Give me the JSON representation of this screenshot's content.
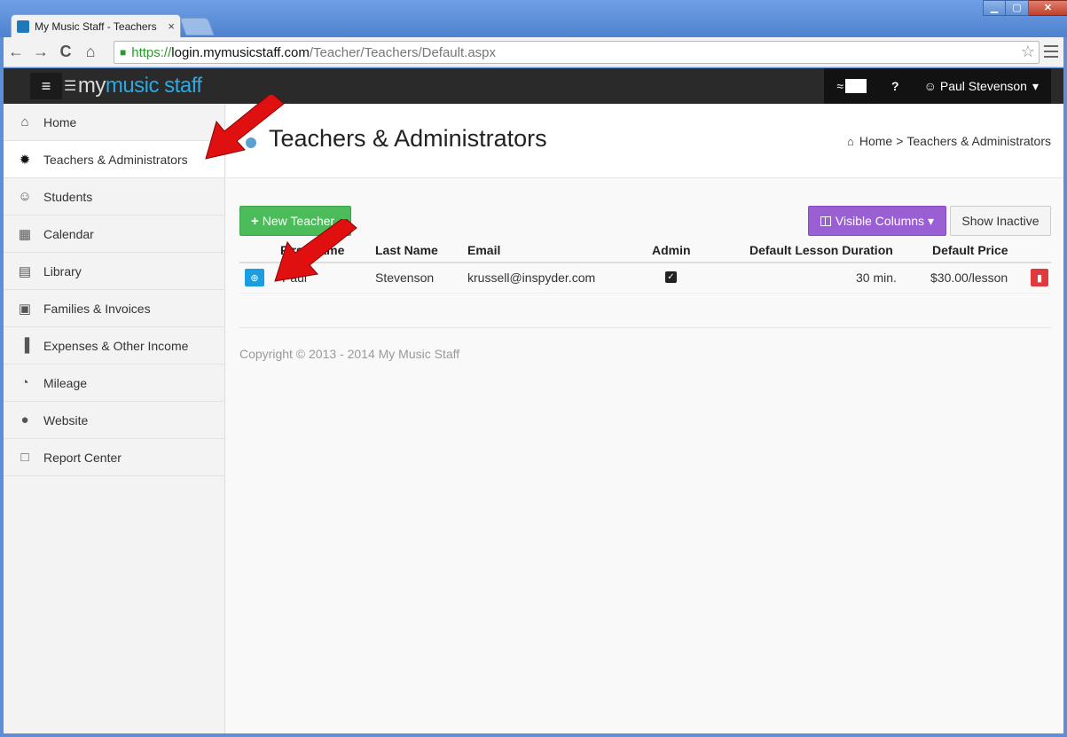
{
  "browser": {
    "tab_title": "My Music Staff - Teachers",
    "tab_close": "×",
    "url_scheme": "https://",
    "url_host": "login.mymusicstaff.com",
    "url_path": "/Teacher/Teachers/Default.aspx",
    "back": "←",
    "forward": "→",
    "reload": "C",
    "home": "⌂",
    "star": "☆",
    "lock": "🔒"
  },
  "topnav": {
    "menu_glyph": "≡",
    "logo_my": "my ",
    "logo_music_staff": "music staff",
    "rss_glyph": "≈",
    "help_glyph": "?",
    "user_glyph": "☺",
    "user_name": "Paul Stevenson",
    "caret": "▾"
  },
  "sidebar": {
    "items": [
      {
        "label": "Home",
        "icon": "⌂"
      },
      {
        "label": "Teachers & Administrators",
        "icon": "✹"
      },
      {
        "label": "Students",
        "icon": "☺"
      },
      {
        "label": "Calendar",
        "icon": "▦"
      },
      {
        "label": "Library",
        "icon": "▤"
      },
      {
        "label": "Families & Invoices",
        "icon": "▣"
      },
      {
        "label": "Expenses & Other Income",
        "icon": "▐"
      },
      {
        "label": "Mileage",
        "icon": "◔"
      },
      {
        "label": "Website",
        "icon": "●"
      },
      {
        "label": "Report Center",
        "icon": "□"
      }
    ]
  },
  "page": {
    "title": "Teachers & Administrators",
    "breadcrumb_home": "Home",
    "breadcrumb_sep": ">",
    "breadcrumb_current": "Teachers & Administrators",
    "new_teacher_label": "New Teacher",
    "visible_columns_label": "Visible Columns",
    "show_inactive_label": "Show Inactive",
    "copyright": "Copyright © 2013 - 2014 My Music Staff"
  },
  "table": {
    "headers": {
      "first_name": "First Name",
      "last_name": "Last Name",
      "email": "Email",
      "admin": "Admin",
      "duration": "Default Lesson Duration",
      "price": "Default Price"
    },
    "rows": [
      {
        "first_name": "Paul",
        "last_name": "Stevenson",
        "email": "krussell@inspyder.com",
        "admin": true,
        "duration": "30 min.",
        "price": "$30.00/lesson"
      }
    ]
  },
  "colors": {
    "accent": "#2ea8e0",
    "green_button": "#4cbb5a",
    "purple_button": "#9b5fd4",
    "delete_red": "#e0393e",
    "annotation_red": "#e01010"
  }
}
